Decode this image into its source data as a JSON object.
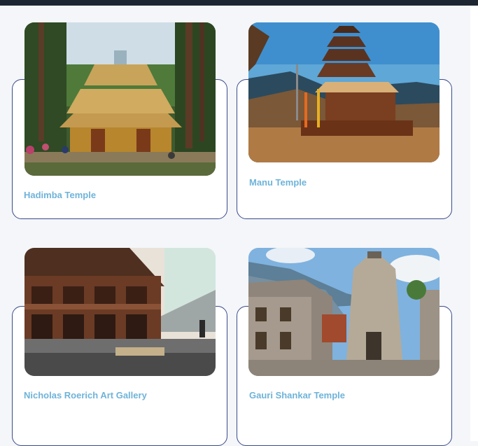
{
  "cards": [
    {
      "title": "Hadimba Temple"
    },
    {
      "title": "Manu Temple"
    },
    {
      "title": "Nicholas Roerich Art Gallery"
    },
    {
      "title": "Gauri Shankar Temple"
    }
  ],
  "colors": {
    "title_text": "#6fb3d9",
    "card_border": "#3b4a8a",
    "top_bar": "#1e2532",
    "page_background": "#f4f6f9"
  }
}
